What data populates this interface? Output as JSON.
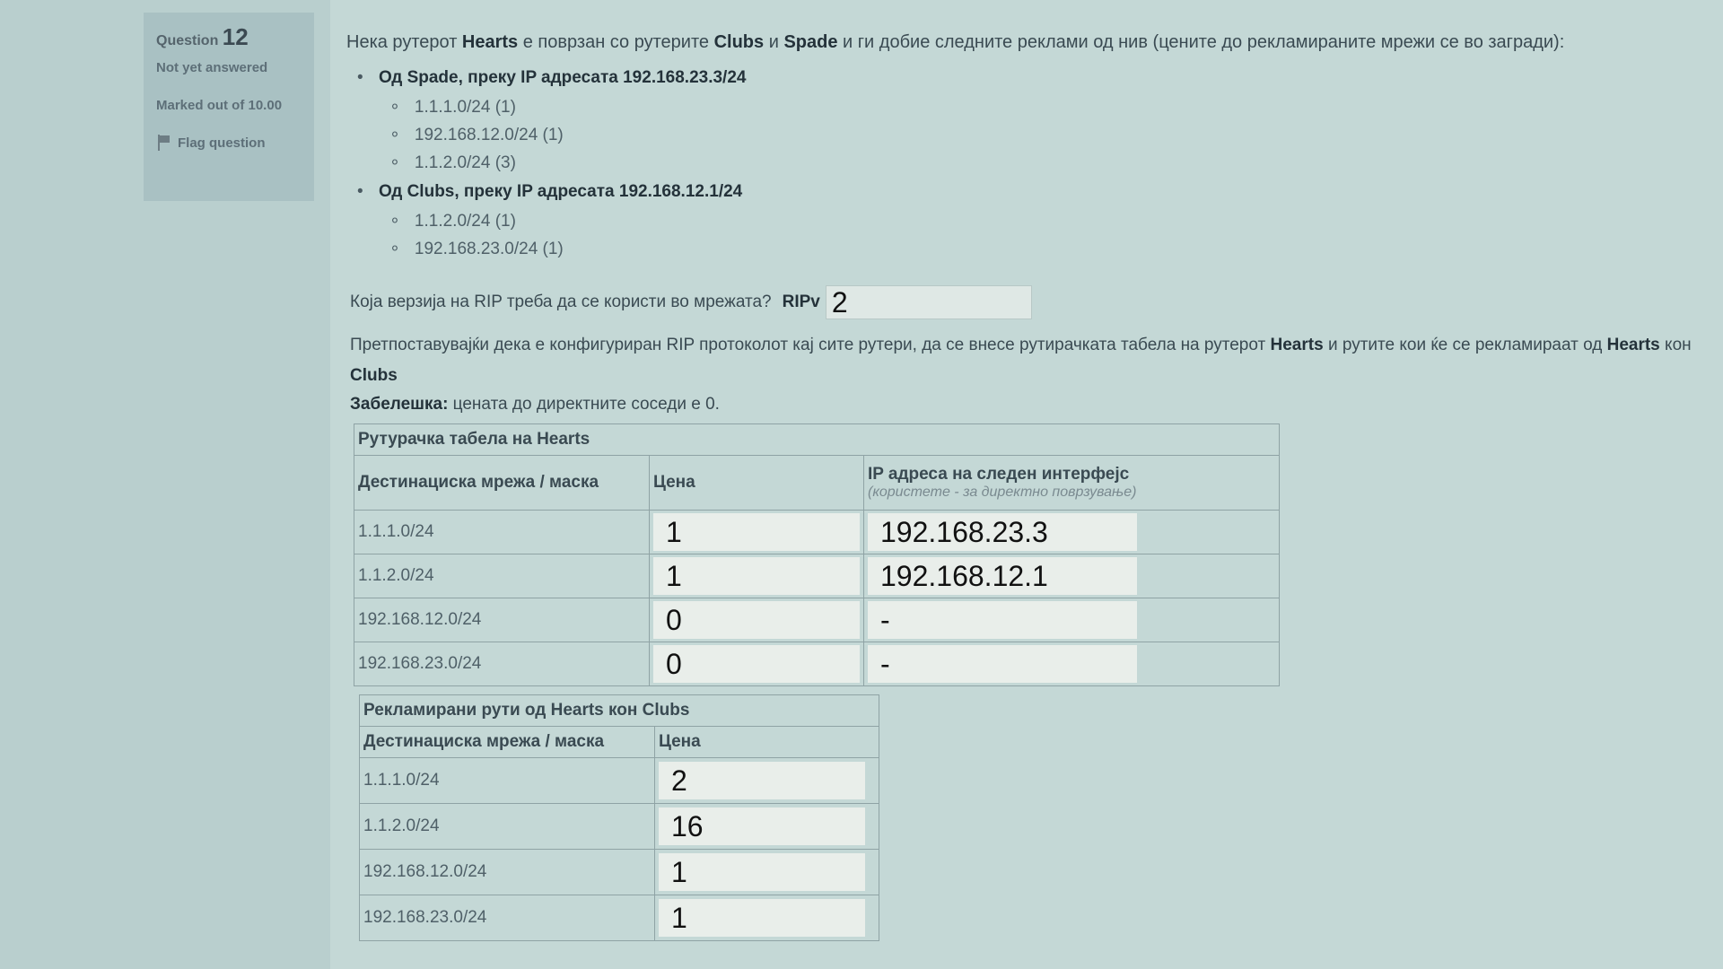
{
  "info": {
    "question_label": "Question",
    "question_number": "12",
    "state": "Not yet answered",
    "marked": "Marked out of 10.00",
    "flag_label": "Flag question"
  },
  "question": {
    "intro_a": "Нека рутерот ",
    "router_hearts": "Hearts",
    "intro_b": " е поврзан со рутерите ",
    "router_clubs": "Clubs",
    "intro_c": " и ",
    "router_spade": "Spade",
    "intro_d": " и ги добие следните реклами од нив (цените до рекламираните мрежи се во загради):",
    "groups": [
      {
        "heading": "Од Spade, преку IP адресата 192.168.23.3/24",
        "routes": [
          "1.1.1.0/24 (1)",
          "192.168.12.0/24 (1)",
          "1.1.2.0/24 (3)"
        ]
      },
      {
        "heading": "Од Clubs, преку IP адресата 192.168.12.1/24",
        "routes": [
          "1.1.2.0/24 (1)",
          "192.168.23.0/24 (1)"
        ]
      }
    ],
    "rip_question": "Која верзија на RIP треба да се користи во мрежата?",
    "rip_prefix": "RIPv",
    "rip_value": "2",
    "assume_a": "Претпоставувајќи дека е конфигуриран RIP протоколот кај сите рутери, да се внесе рутирачката табела на рутерот ",
    "assume_hearts": "Hearts",
    "assume_b": " и рутите кои ќе се рекламираат од ",
    "assume_hearts2": "Hearts",
    "assume_c": " кон ",
    "assume_clubs": "Clubs",
    "note_label": "Забелешка:",
    "note_text": " цената до директните соседи е 0."
  },
  "table1": {
    "caption": "Рутурачка табела на Hearts",
    "col_dest": "Дестинациска мрежа / маска",
    "col_cost": "Цена",
    "col_ip": "IP адреса на следен интерфејс",
    "col_ip_hint": "(користете - за директно поврзување)",
    "rows": [
      {
        "dest": "1.1.1.0/24",
        "cost": "1",
        "ip": "192.168.23.3"
      },
      {
        "dest": "1.1.2.0/24",
        "cost": "1",
        "ip": "192.168.12.1"
      },
      {
        "dest": "192.168.12.0/24",
        "cost": "0",
        "ip": "-"
      },
      {
        "dest": "192.168.23.0/24",
        "cost": "0",
        "ip": "-"
      }
    ]
  },
  "table2": {
    "caption": "Рекламирани рути од Hearts кон Clubs",
    "col_dest": "Дестинациска мрежа / маска",
    "col_cost": "Цена",
    "rows": [
      {
        "dest": "1.1.1.0/24",
        "cost": "2"
      },
      {
        "dest": "1.1.2.0/24",
        "cost": "16"
      },
      {
        "dest": "192.168.12.0/24",
        "cost": "1"
      },
      {
        "dest": "192.168.23.0/24",
        "cost": "1"
      }
    ]
  }
}
